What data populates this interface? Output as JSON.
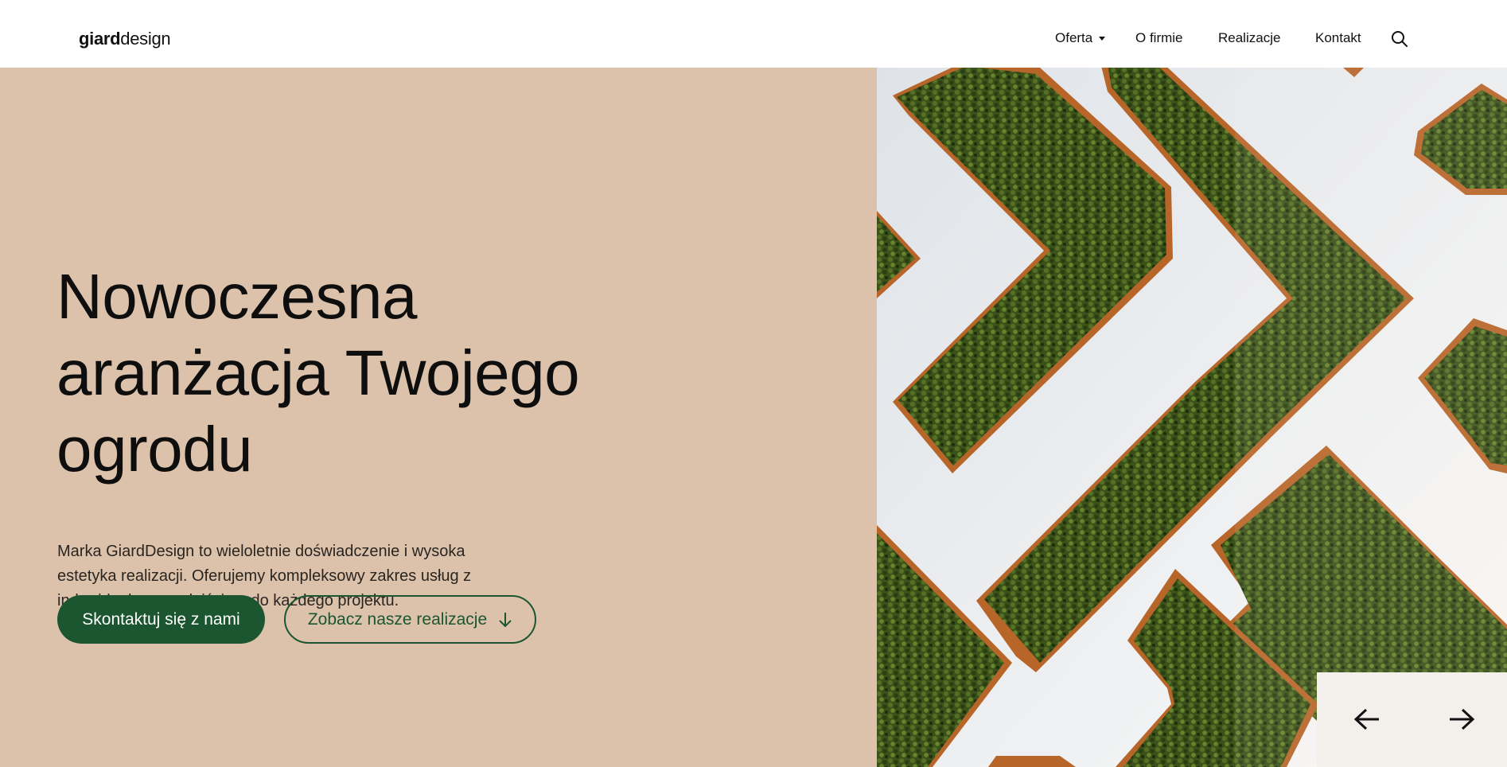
{
  "brand": {
    "bold": "giard",
    "regular": "design"
  },
  "nav": {
    "items": [
      {
        "label": "Oferta",
        "has_dropdown": true
      },
      {
        "label": "O firmie"
      },
      {
        "label": "Realizacje"
      },
      {
        "label": "Kontakt"
      }
    ],
    "search_icon": "search-icon"
  },
  "hero": {
    "title_lines": [
      "Nowoczesna",
      "aranżacja Twojego",
      "ogrodu"
    ],
    "description": "Marka GiardDesign to wieloletnie doświadczenie i wysoka estetyka realizacji. Oferujemy kompleksowy zakres usług z indywidualnym podejściem do każdego projektu.",
    "primary_button": "Skontaktuj się z nami",
    "secondary_button": "Zobacz nasze realizacje",
    "secondary_icon": "arrow-down-icon"
  },
  "slider": {
    "prev_icon": "arrow-left-icon",
    "next_icon": "arrow-right-icon"
  },
  "colors": {
    "hero_bg": "#dcc2ab",
    "accent_green": "#1b5630",
    "slider_controls_bg": "#f3efea",
    "planter_wood": "#b8652a",
    "hedge_green": "#3f5a1d"
  }
}
